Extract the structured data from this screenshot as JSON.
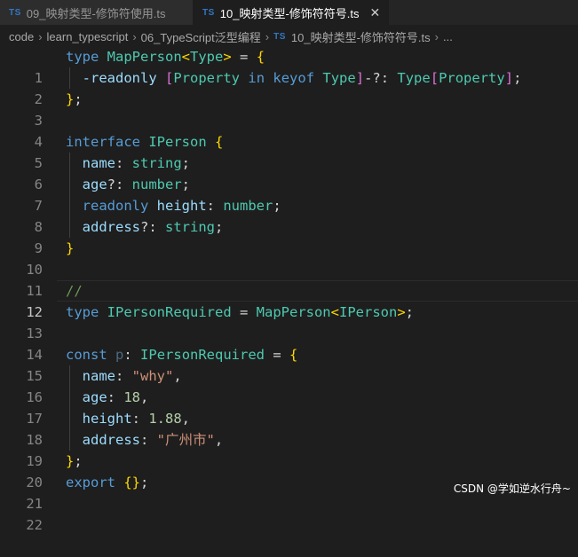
{
  "tabs": [
    {
      "badge": "TS",
      "label": "09_映射类型-修饰符使用.ts"
    },
    {
      "badge": "TS",
      "label": "10_映射类型-修饰符符号.ts",
      "close": "✕"
    }
  ],
  "breadcrumb": [
    "code",
    "learn_typescript",
    "06_TypeScript泛型编程",
    "10_映射类型-修饰符符号.ts",
    "..."
  ],
  "line_numbers": [
    "1",
    "2",
    "3",
    "4",
    "5",
    "6",
    "7",
    "8",
    "9",
    "10",
    "11",
    "12",
    "13",
    "14",
    "15",
    "16",
    "17",
    "18",
    "19",
    "20",
    "21",
    "22"
  ],
  "code": {
    "l1": [
      "type",
      "MapPerson",
      "<",
      "Type",
      ">",
      " = ",
      "{"
    ],
    "l2": [
      "-readonly",
      "[",
      "Property",
      "in",
      "keyof",
      "Type",
      "]",
      "-?: ",
      "Type",
      "[",
      "Property",
      "]",
      ";"
    ],
    "l3": [
      "}",
      ";"
    ],
    "l5": [
      "interface",
      "IPerson",
      "{"
    ],
    "l6": [
      "name",
      ": ",
      "string",
      ";"
    ],
    "l7": [
      "age",
      "?: ",
      "number",
      ";"
    ],
    "l8": [
      "readonly",
      "height",
      ": ",
      "number",
      ";"
    ],
    "l9": [
      "address",
      "?: ",
      "string",
      ";"
    ],
    "l10": [
      "}"
    ],
    "l12": [
      "//"
    ],
    "l13": [
      "type",
      "IPersonRequired",
      " = ",
      "MapPerson",
      "<",
      "IPerson",
      ">",
      ";"
    ],
    "l15": [
      "const",
      "p",
      ": ",
      "IPersonRequired",
      " = ",
      "{"
    ],
    "l16": [
      "name",
      ": ",
      "\"why\"",
      ","
    ],
    "l17": [
      "age",
      ": ",
      "18",
      ","
    ],
    "l18": [
      "height",
      ": ",
      "1.88",
      ","
    ],
    "l19": [
      "address",
      ": ",
      "\"广州市\"",
      ","
    ],
    "l20": [
      "}",
      ";"
    ],
    "l21": [
      "export",
      "{}",
      ";"
    ]
  },
  "watermark": "CSDN @学如逆水行舟~",
  "colors": {
    "keyword": "#569cd6",
    "type": "#4ec9b0",
    "variable": "#9cdcfe",
    "string": "#ce9178",
    "number": "#b5cea8",
    "comment": "#6a9955",
    "bracket_gold": "#ffd700",
    "bracket_purple": "#da70d6"
  }
}
